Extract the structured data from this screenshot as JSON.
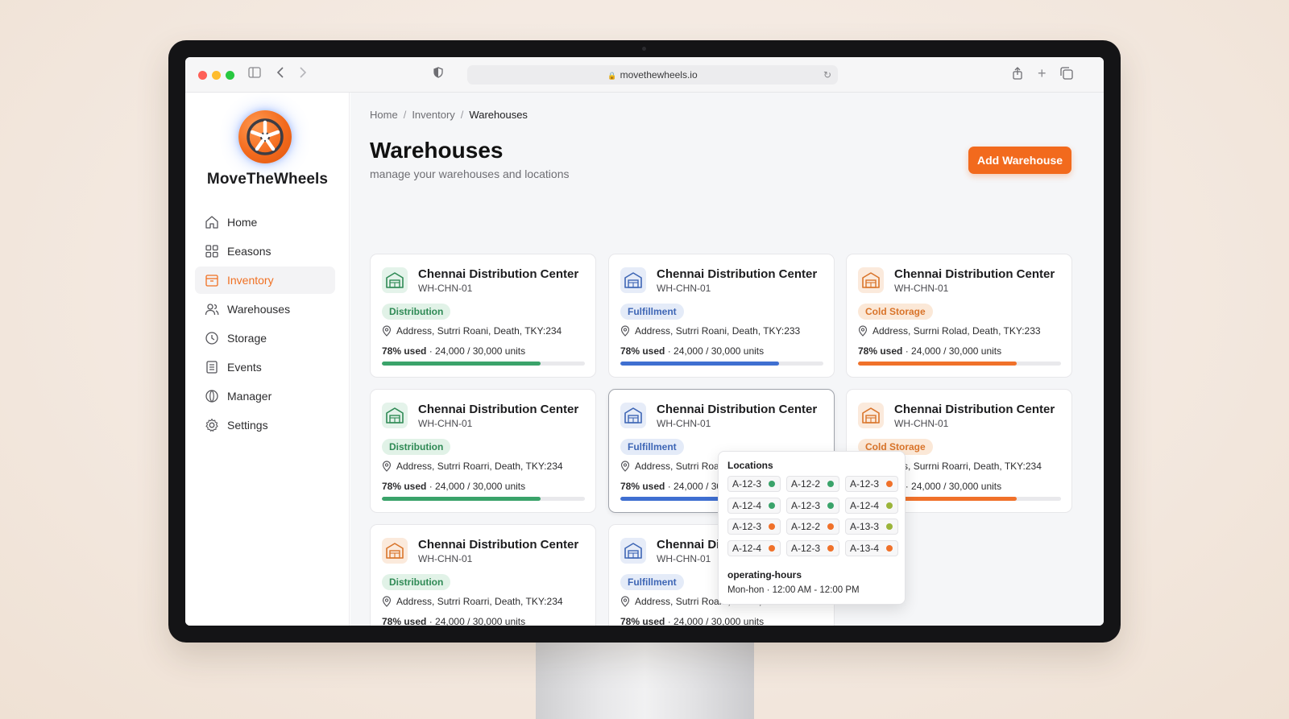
{
  "browser": {
    "url": "movethewheels.io"
  },
  "brand": {
    "name": "MoveTheWheels",
    "accent_color": "#f26a1d"
  },
  "sidebar": {
    "items": [
      {
        "label": "Home",
        "icon": "home-icon",
        "active": false
      },
      {
        "label": "Eeasons",
        "icon": "grid-icon",
        "active": false
      },
      {
        "label": "Inventory",
        "icon": "inventory-icon",
        "active": true
      },
      {
        "label": "Warehouses",
        "icon": "users-icon",
        "active": false
      },
      {
        "label": "Storage",
        "icon": "clock-icon",
        "active": false
      },
      {
        "label": "Events",
        "icon": "list-icon",
        "active": false
      },
      {
        "label": "Manager",
        "icon": "manager-icon",
        "active": false
      },
      {
        "label": "Settings",
        "icon": "gear-icon",
        "active": false
      }
    ]
  },
  "breadcrumb": {
    "items": [
      "Home",
      "Inventory",
      "Warehouses"
    ],
    "separator": "/"
  },
  "header": {
    "title": "Warehouses",
    "subtitle": "manage your warehouses and locations",
    "add_button": "Add Warehouse"
  },
  "cards": [
    {
      "title": "Chennai Distribution Center",
      "code": "WH-CHN-01",
      "type": "Distribution",
      "color": "green",
      "bar_color": "green",
      "address": "Address, Sutrri Roani, Death, TKY:234",
      "used": "78% used",
      "units": "· 24,000 / 30,000 units",
      "progress": 0.78
    },
    {
      "title": "Chennai Distribution Center",
      "code": "WH-CHN-01",
      "type": "Fulfillment",
      "color": "blue",
      "bar_color": "blue",
      "address": "Address, Sutrri Roani, Death, TKY:233",
      "used": "78% used",
      "units": "· 24,000 / 30,000 units",
      "progress": 0.78
    },
    {
      "title": "Chennai Distribution Center",
      "code": "WH-CHN-01",
      "type": "Cold Storage",
      "color": "orange",
      "bar_color": "orange",
      "address": "Address, Surrni Rolad, Death, TKY:233",
      "used": "78% used",
      "units": "· 24,000 / 30,000 units",
      "progress": 0.78
    },
    {
      "title": "Chennai Distribution Center",
      "code": "WH-CHN-01",
      "type": "Distribution",
      "color": "green",
      "bar_color": "green",
      "address": "Address, Sutrri Roarri, Death, TKY:234",
      "used": "78% used",
      "units": "· 24,000 / 30,000 units",
      "progress": 0.78
    },
    {
      "title": "Chennai Distribution Center",
      "code": "WH-CHN-01",
      "type": "Fulfillment",
      "color": "blue",
      "bar_color": "blue",
      "address": "Address, Sutrri Roarri, Death, TKY:233",
      "used": "78% used",
      "units": "· 24,000 / 30,000 units",
      "progress": 0.78
    },
    {
      "title": "Chennai Distribution Center",
      "code": "WH-CHN-01",
      "type": "Cold Storage",
      "color": "orange",
      "bar_color": "orange",
      "address": "Address, Surrni Roarri, Death, TKY:234",
      "used": "78% used",
      "units": "· 24,000 / 30,000 units",
      "progress": 0.78
    },
    {
      "title": "Chennai Distribution Center",
      "code": "WH-CHN-01",
      "type": "Distribution",
      "color": "orange",
      "bar_color": "orange",
      "address": "Address, Sutrri Roarri, Death, TKY:234",
      "used": "78% used",
      "units": "· 24,000 / 30,000 units",
      "progress": 0.78
    },
    {
      "title": "Chennai Distribution Center",
      "code": "WH-CHN-01",
      "type": "Fulfillment",
      "color": "blue",
      "bar_color": "blue",
      "address": "Address, Sutrri Roarri, Death, TKY:233",
      "used": "78% used",
      "units": "· 24,000 / 30,000 units",
      "progress": 0.78
    }
  ],
  "popover": {
    "title": "Locations",
    "locations": [
      {
        "code": "A-12-3",
        "status_color": "#3aa36a"
      },
      {
        "code": "A-12-2",
        "status_color": "#3aa36a"
      },
      {
        "code": "A-12-3",
        "status_color": "#f0712a"
      },
      {
        "code": "A-12-4",
        "status_color": "#3aa36a"
      },
      {
        "code": "A-12-3",
        "status_color": "#3aa36a"
      },
      {
        "code": "A-12-4",
        "status_color": "#9bb43a"
      },
      {
        "code": "A-12-3",
        "status_color": "#f0712a"
      },
      {
        "code": "A-12-2",
        "status_color": "#f0712a"
      },
      {
        "code": "A-13-3",
        "status_color": "#9bb43a"
      },
      {
        "code": "A-12-4",
        "status_color": "#f0712a"
      },
      {
        "code": "A-12-3",
        "status_color": "#f0712a"
      },
      {
        "code": "A-13-4",
        "status_color": "#f0712a"
      }
    ],
    "hours_label": "operating-hours",
    "hours_value": "Mon-hon · 12:00 AM - 12:00 PM"
  }
}
